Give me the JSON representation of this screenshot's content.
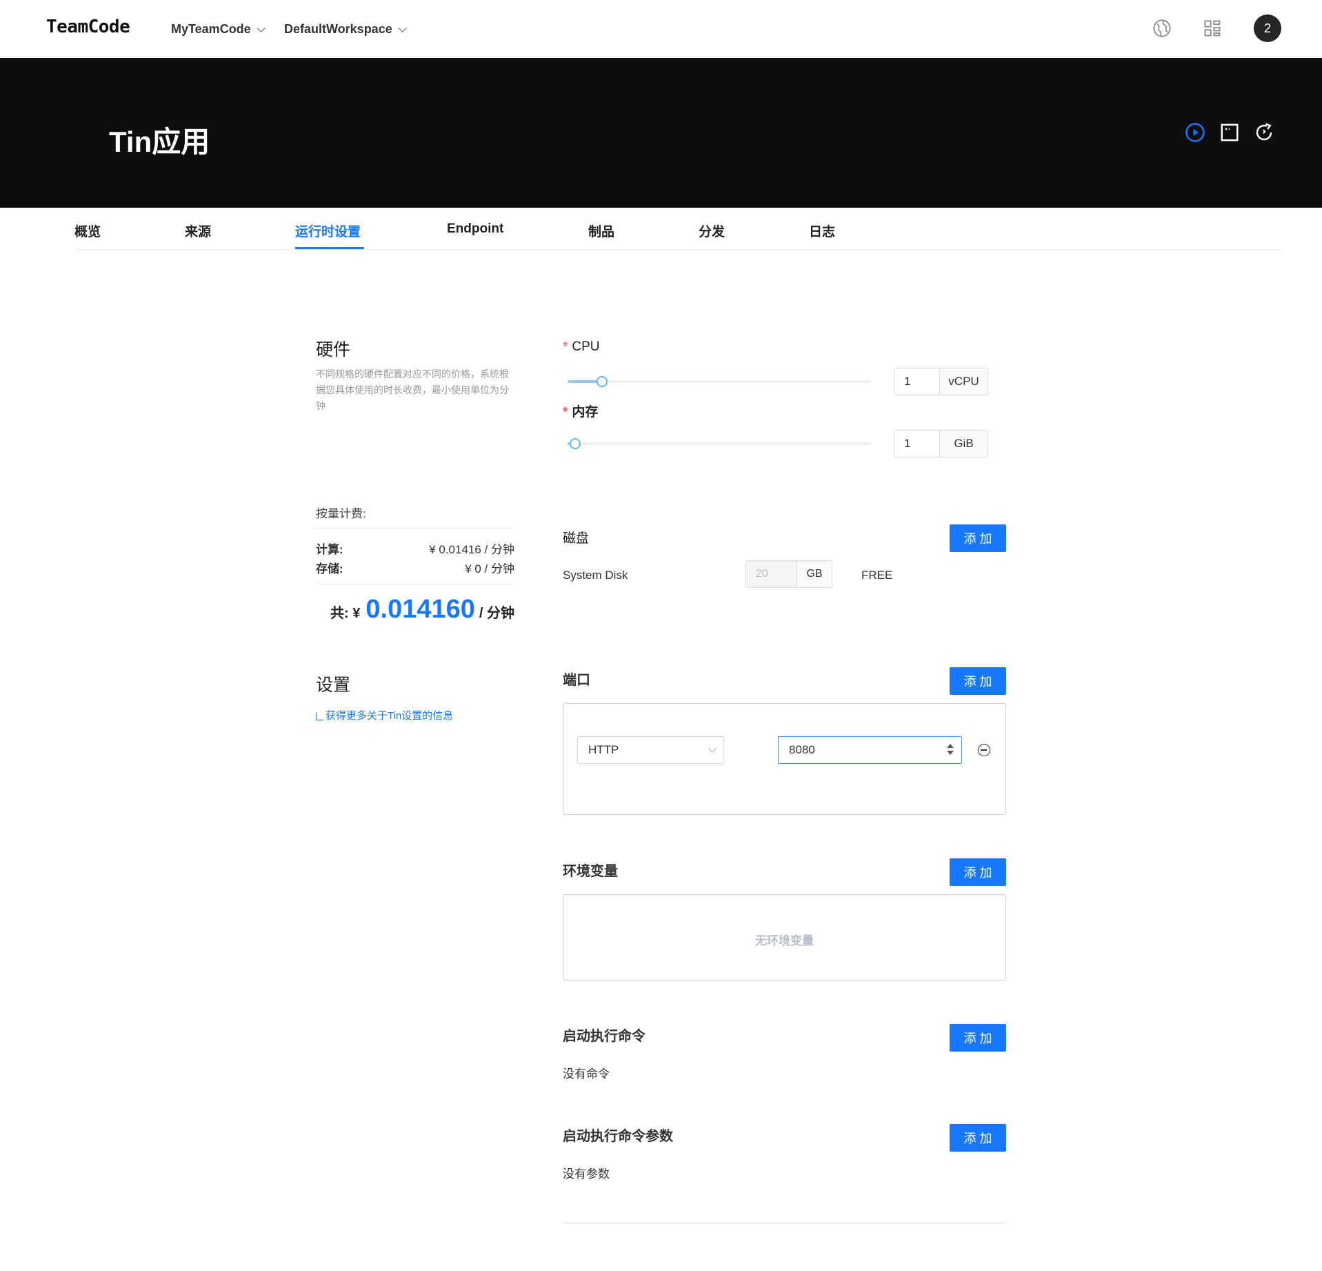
{
  "topnav": {
    "logo": "TeamCode",
    "org_dropdown": "MyTeamCode",
    "workspace_dropdown": "DefaultWorkspace",
    "avatar_text": "2"
  },
  "banner": {
    "title": "Tin应用"
  },
  "tabs": [
    {
      "label": "概览"
    },
    {
      "label": "来源"
    },
    {
      "label": "运行时设置"
    },
    {
      "label": "Endpoint"
    },
    {
      "label": "制品"
    },
    {
      "label": "分发"
    },
    {
      "label": "日志"
    }
  ],
  "active_tab": "运行时设置",
  "hardware": {
    "title": "硬件",
    "description": "不同规格的硬件配置对应不同的价格，系统根据您具体使用的时长收费，最小使用单位为分钟",
    "cpu": {
      "label": "CPU",
      "value": "1",
      "unit": "vCPU",
      "slider_fraction": 0.11
    },
    "memory": {
      "label": "内存",
      "value": "1",
      "unit": "GiB",
      "slider_fraction": 0.02
    }
  },
  "billing": {
    "title": "按量计费:",
    "compute_label": "计算:",
    "compute_price": "¥ 0.01416 / 分钟",
    "storage_label": "存储:",
    "storage_price": "¥ 0 / 分钟",
    "total_label": "共: ¥",
    "total_value": "0.014160",
    "total_unit": "/ 分钟"
  },
  "settings": {
    "title": "设置",
    "link": "获得更多关于Tin设置的信息"
  },
  "disk": {
    "title": "磁盘",
    "add_label": "添加",
    "name": "System Disk",
    "size": "20",
    "unit": "GB",
    "tier": "FREE"
  },
  "ports": {
    "title": "端口",
    "add_label": "添加",
    "protocol": "HTTP",
    "port": "8080"
  },
  "env": {
    "title": "环境变量",
    "add_label": "添加",
    "empty": "无环境变量"
  },
  "startup_command": {
    "title": "启动执行命令",
    "add_label": "添加",
    "empty": "没有命令"
  },
  "startup_args": {
    "title": "启动执行命令参数",
    "add_label": "添加",
    "empty": "没有参数"
  },
  "colors": {
    "accent": "#1677ff",
    "banner": "#0e0e0e",
    "required": "#ff4d4f"
  }
}
